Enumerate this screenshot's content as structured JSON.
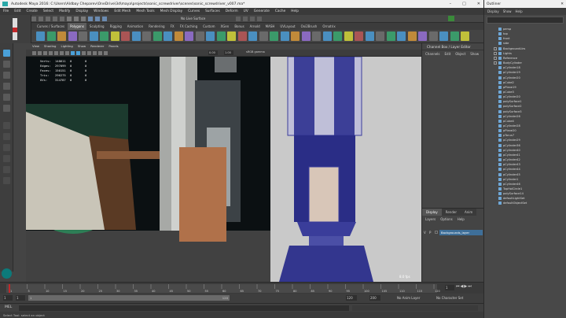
{
  "window": {
    "title": "Autodesk Maya 2016: C:\\Users\\Aldbay Cheparev\\OneDrive\\3d\\maya\\projects\\sonic_screwdriver\\scenes\\sonic_screwdriver_v007.ma*"
  },
  "menubar": [
    "File",
    "Edit",
    "Create",
    "Select",
    "Modify",
    "Display",
    "Windows",
    "Edit Mesh",
    "Mesh Tools",
    "Mesh Display",
    "Curves",
    "Surfaces",
    "Deform",
    "UV",
    "Generate",
    "Cache",
    "Help"
  ],
  "status": {
    "live_surface": "No Live Surface"
  },
  "shelf_tabs": [
    "Curves / Surfaces",
    "Polygons",
    "Sculpting",
    "Rigging",
    "Animation",
    "Rendering",
    "FX",
    "FX Caching",
    "Custom",
    "XGen",
    "Bonus",
    "Arnold",
    "MASH",
    "UVLayout",
    "Oxi2Brush",
    "Ornatrix"
  ],
  "shelf_active": "Polygons",
  "viewport": {
    "menu": [
      "View",
      "Shading",
      "Lighting",
      "Show",
      "Renderer",
      "Panels"
    ],
    "gamma": "0.00",
    "exposure": "1.00",
    "color_space": "sRGB gamma",
    "hud": [
      {
        "label": "Verts:",
        "v1": "148611",
        "v2": "0",
        "v3": "0"
      },
      {
        "label": "Edges:",
        "v1": "297099",
        "v2": "0",
        "v3": "0"
      },
      {
        "label": "Faces:",
        "v1": "150151",
        "v2": "0",
        "v3": "0"
      },
      {
        "label": "Tris:",
        "v1": "296275",
        "v2": "0",
        "v3": "0"
      },
      {
        "label": "UVs:",
        "v1": "314787",
        "v2": "0",
        "v3": "0"
      }
    ],
    "fps": "8.0 fps"
  },
  "channel_box": {
    "title": "Channel Box / Layer Editor",
    "menu": [
      "Channels",
      "Edit",
      "Object",
      "Show"
    ]
  },
  "layers": {
    "tabs": [
      "Display",
      "Render",
      "Anim"
    ],
    "menu": [
      "Layers",
      "Options",
      "Help"
    ],
    "row": {
      "v": "V",
      "p": "P",
      "name": "Backgrounds_layer"
    }
  },
  "timeline": {
    "ticks": [
      "1",
      "5",
      "10",
      "15",
      "20",
      "25",
      "30",
      "35",
      "40",
      "45",
      "50",
      "55",
      "60",
      "65",
      "70",
      "75",
      "80",
      "85",
      "90",
      "95",
      "100",
      "105",
      "110",
      "115",
      "120"
    ],
    "current": "1"
  },
  "range": {
    "start": "1",
    "inner_start": "1",
    "inner_end": "120",
    "end": "120",
    "anim_end": "200",
    "anim_layer": "No Anim Layer",
    "char_set": "No Character Set"
  },
  "mel": "MEL",
  "helpline": "Select Tool: select an object",
  "outliner": {
    "title": "Outliner",
    "menu": [
      "Display",
      "Show",
      "Help"
    ],
    "items": [
      "persp",
      "top",
      "front",
      "side",
      "BackgroundLtrs",
      "Lights",
      "Reference",
      "BodyCylinder",
      "pCylinder18",
      "pCylinder19",
      "pCylinder20",
      "pCube2",
      "pPlane19",
      "pCube3",
      "pCylinder20",
      "polySurface1",
      "polySurface2",
      "polySurface3",
      "pCylinder26",
      "pCube4",
      "pCylinder28",
      "pPlane20",
      "pTorus7",
      "pCylinder29",
      "pCylinder36",
      "pCylinder40",
      "pCylinder41",
      "pCylinder42",
      "pCylinder43",
      "pCylinder44",
      "pCylinder45",
      "pCylinder1",
      "pCylinder46",
      "TopHolCircle1",
      "polySurface14",
      "defaultLightSet",
      "defaultObjectSet"
    ]
  },
  "colors": {
    "accent": "#4aa0d8",
    "mesh_wire": "#3b3d9c",
    "background": "#444444"
  }
}
